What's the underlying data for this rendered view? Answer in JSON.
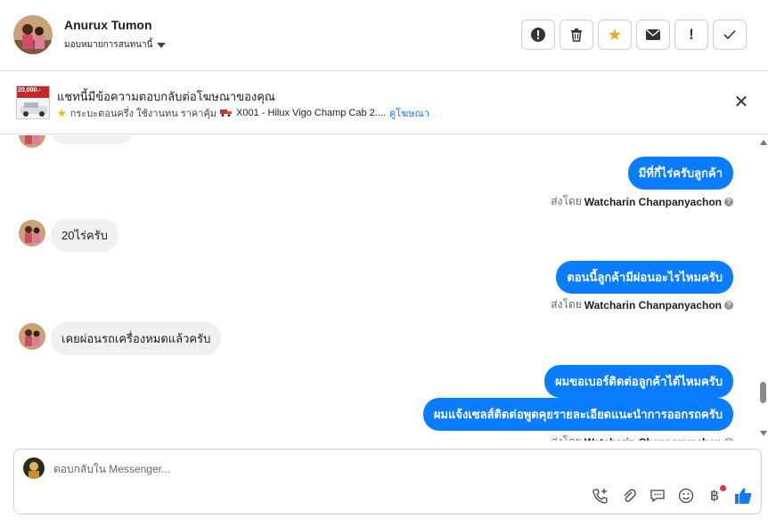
{
  "header": {
    "name": "Anurux Tumon",
    "assign_label": "มอบหมายการสนทนานี้",
    "actions": [
      {
        "icon": "alert-circle-icon",
        "glyph": "!"
      },
      {
        "icon": "trash-icon",
        "glyph": ""
      },
      {
        "icon": "star-icon",
        "glyph": "★"
      },
      {
        "icon": "envelope-icon",
        "glyph": ""
      },
      {
        "icon": "exclamation-icon",
        "glyph": "!"
      },
      {
        "icon": "check-icon",
        "glyph": "✓"
      }
    ],
    "star_color": "#f5a623"
  },
  "banner": {
    "title": "แชทนี้มีข้อความตอบกลับต่อโฆษณาของคุณ",
    "ad_text": "กระบะตอนครึ่ง ใช้งานทน ราคาคุ้ม",
    "model": "X001 - Hilux Vigo Champ Cab 2....",
    "view_ad": "ดูโฆษณา",
    "ad_thumb_price": "20,000.-"
  },
  "chat": {
    "messages": [
      {
        "dir": "out",
        "text": "มีที่กี่ไร่ครับลูกค้า"
      },
      {
        "dir": "in",
        "text": "20ไร่ครับ"
      },
      {
        "dir": "out",
        "text": "ตอนนี้ลูกค้ามีผ่อนอะไรไหมครับ"
      },
      {
        "dir": "in",
        "text": "เคยผ่อนรถเครื่องหมดแล้วครับ"
      },
      {
        "dir": "out",
        "text": "ผมขอเบอร์ติดต่อลูกค้าได้ไหมครับ"
      },
      {
        "dir": "out",
        "text": "ผมแจ้งเซลส์ติดต่อพูดคุยรายละเอียดแนะนำการออกรถครับ"
      }
    ],
    "sent_by_prefix": "ส่งโดย",
    "sent_by_name": "Watcharin Chanpanyachon"
  },
  "composer": {
    "placeholder": "ตอบกลับใน Messenger..."
  },
  "colors": {
    "outgoing_bubble": "#0a7cff",
    "incoming_bubble": "#f0f0f0",
    "link": "#1877f2",
    "like": "#1877f2",
    "notification_dot": "#f02849"
  }
}
